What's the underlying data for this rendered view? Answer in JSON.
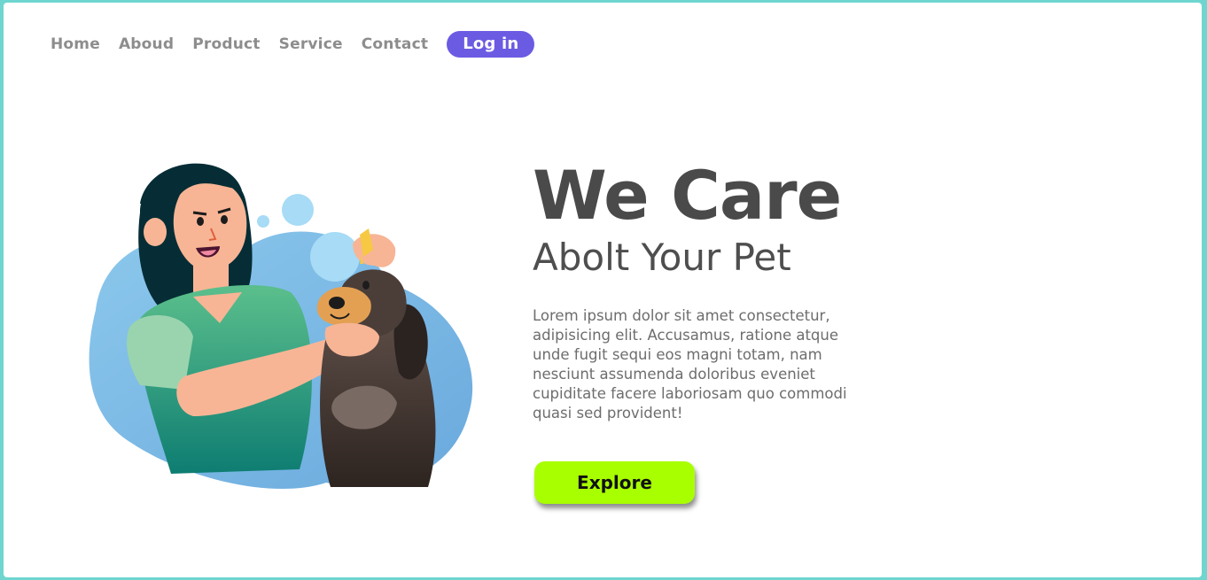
{
  "nav": {
    "items": [
      {
        "label": "Home"
      },
      {
        "label": "Aboud"
      },
      {
        "label": "Product"
      },
      {
        "label": "Service"
      },
      {
        "label": "Contact"
      }
    ],
    "login_label": "Log in"
  },
  "hero": {
    "title": "We Care",
    "subtitle": "Abolt Your Pet",
    "body": "Lorem ipsum dolor sit amet consectetur, adipisicing elit. Accusamus, ratione atque unde fugit sequi eos magni totam, nam nesciunt assumenda doloribus eveniet cupiditate facere laboriosam quo commodi quasi sed provident!",
    "button_label": "Explore"
  },
  "colors": {
    "accent": "#6b5be3",
    "button": "#a8ff00",
    "frame": "#6fd6cf"
  },
  "illustration": {
    "icon": "woman-giving-dog-eye-drops-illustration"
  }
}
